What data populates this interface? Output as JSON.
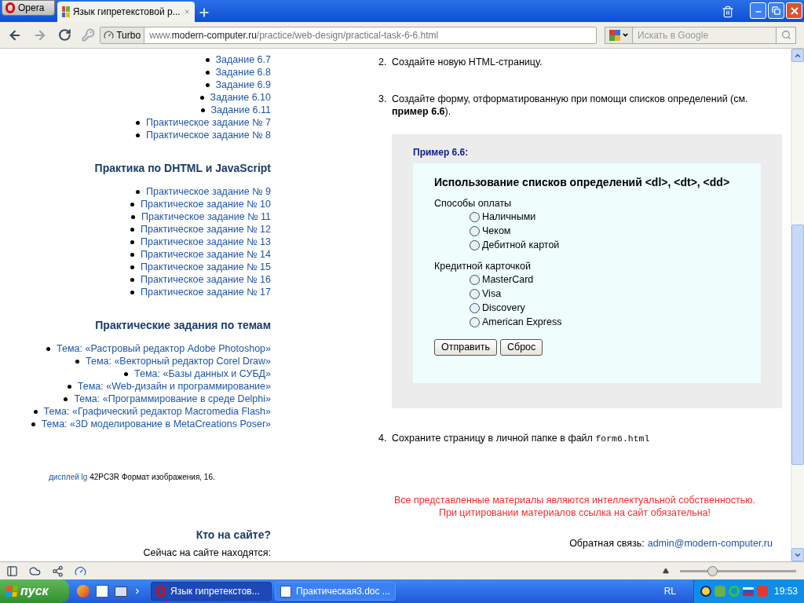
{
  "browser": {
    "menu_button": "Opera",
    "tab": {
      "title": "Язык гипретекстовой р...",
      "selected": true
    },
    "turbo": "Turbo",
    "address": {
      "prefix": "www.",
      "domain": "modern-computer.ru",
      "path": "/practice/web-design/practical-task-6-6.html"
    },
    "search": {
      "placeholder": "Искать в Google"
    }
  },
  "sidebar": {
    "top_list": {
      "subtasks": [
        "Задание 6.7",
        "Задание 6.8",
        "Задание 6.9",
        "Задание 6.10",
        "Задание 6.11"
      ],
      "tasks": [
        "Практическое задание № 7",
        "Практическое задание № 8"
      ]
    },
    "sections": [
      {
        "heading": "Практика по DHTML и JavaScript",
        "items": [
          "Практическое задание № 9",
          "Практическое задание № 10",
          "Практическое задание № 11",
          "Практическое задание № 12",
          "Практическое задание № 13",
          "Практическое задание № 14",
          "Практическое задание № 15",
          "Практическое задание № 16",
          "Практическое задание № 17"
        ]
      },
      {
        "heading": "Практические задания по темам",
        "items": [
          "Тема: «Растровый редактор Adobe Photoshop»",
          "Тема: «Векторный редактор Corel Draw»",
          "Тема: «Базы данных и СУБД»",
          "Тема: «Web-дизайн и программирование»",
          "Тема: «Программирование в среде Delphi»",
          "Тема: «Графический редактор Macromedia Flash»",
          "Тема: «3D моделирование в MetaCreations Poser»"
        ]
      }
    ],
    "ad": {
      "link": "дисплей lg",
      "text": "42PC3R Формат изображения, 16."
    },
    "who_online": {
      "heading": "Кто на сайте?",
      "lines": [
        "Сейчас на сайте находятся:"
      ]
    }
  },
  "steps": [
    {
      "number": "2.",
      "text": "Создайте новую HTML-страницу."
    },
    {
      "number": "3.",
      "text": "Создайте форму, отформатированную при помощи списков определений (см. **пример 6.6**)."
    }
  ],
  "example": {
    "caption": "Пример 6.6:",
    "title": "Использование списков определений <dl>, <dt>, <dd>",
    "groups": [
      {
        "label": "Способы оплаты",
        "options": [
          {
            "label": "Наличными",
            "selected": false
          },
          {
            "label": "Чеком",
            "selected": false
          },
          {
            "label": "Дебитной картой",
            "selected": false
          }
        ]
      },
      {
        "label": "Кредитной карточкой",
        "options": [
          {
            "label": "MasterCard",
            "selected": false
          },
          {
            "label": "Visa",
            "selected": false
          },
          {
            "label": "Discovery",
            "selected": false
          },
          {
            "label": "American Express",
            "selected": false
          }
        ]
      }
    ],
    "buttons": [
      "Отправить",
      "Сброс"
    ]
  },
  "last_step": {
    "number": "4.",
    "text": "Сохраните страницу в личной папке в файл",
    "code": "form6.html"
  },
  "notice": [
    "Все представленные материалы являются интеллектуальной собственностью.",
    "При цитировании материалов ссылка на сайт обязательна!"
  ],
  "feedback": {
    "label": "Обратная связь:",
    "email": "admin@modern-computer.ru"
  },
  "status_bar": {
    "zoom": {
      "level": 0.28
    }
  },
  "taskbar": {
    "start": "пуск",
    "tasks": [
      {
        "label": "Язык гипретекстов...",
        "selected": true
      },
      {
        "label": "Практическая3.doc ...",
        "selected": false
      }
    ],
    "language": "RL",
    "clock": "19:53"
  }
}
